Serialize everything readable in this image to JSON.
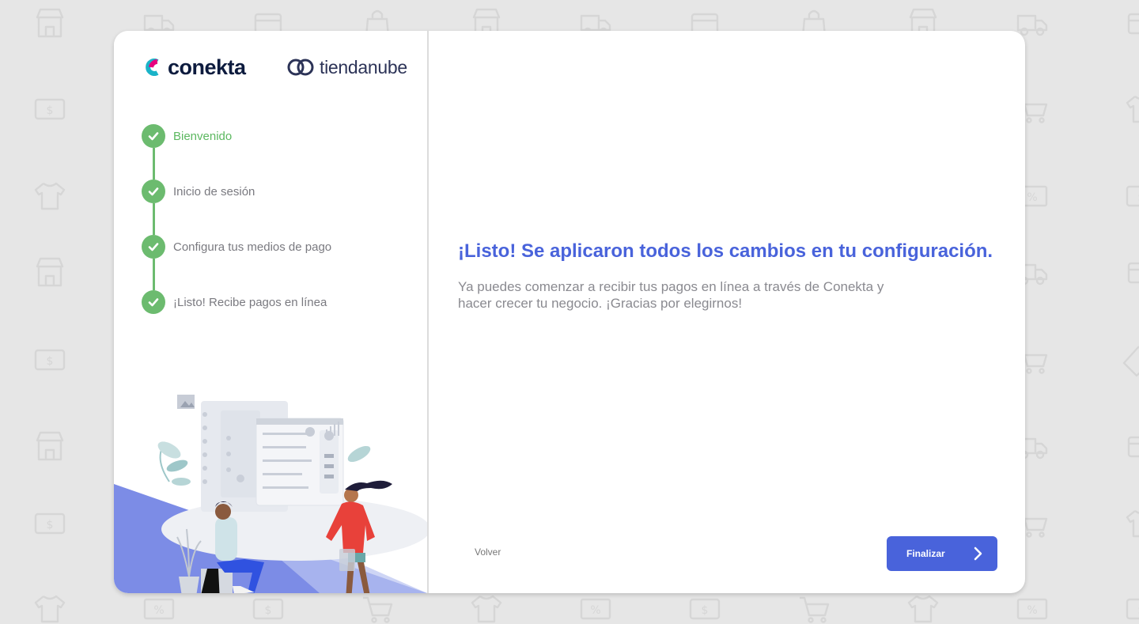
{
  "brand": {
    "conekta_name": "conekta",
    "tiendanube_name": "tiendanube",
    "accent_color": "#4963db",
    "success_color": "#6cbb6f"
  },
  "steps": [
    {
      "label": "Bienvenido",
      "status": "complete",
      "active": true
    },
    {
      "label": "Inicio de sesión",
      "status": "complete",
      "active": false
    },
    {
      "label": "Configura tus medios de pago",
      "status": "complete",
      "active": false
    },
    {
      "label": "¡Listo! Recibe pagos en línea",
      "status": "complete",
      "active": false
    }
  ],
  "main": {
    "title": "¡Listo! Se aplicaron todos los cambios en tu configuración.",
    "description_line1": "Ya puedes comenzar a recibir tus pagos en línea a través de Conekta y",
    "description_line2": "hacer crecer tu negocio. ¡Gracias por elegirnos!"
  },
  "footer": {
    "back_label": "Volver",
    "next_label": "Finalizar"
  },
  "icons": {
    "step_status": "check-icon",
    "next": "chevron-right-icon",
    "background": [
      "store-icon",
      "truck-icon",
      "wallet-icon",
      "bag-icon",
      "cash-icon",
      "cart-icon",
      "shirt-icon",
      "discount-icon",
      "tag-icon"
    ]
  }
}
